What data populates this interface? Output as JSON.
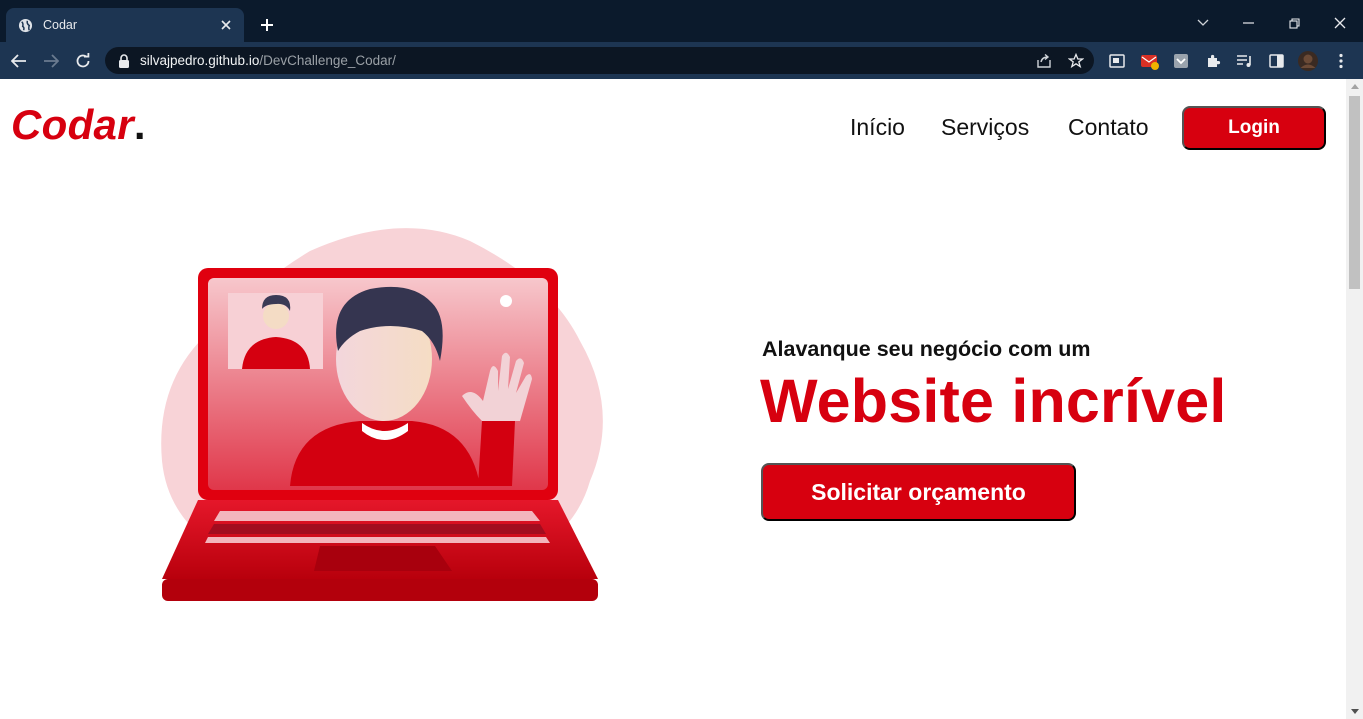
{
  "browser": {
    "tab_title": "Codar",
    "url_host": "silvajpedro.github.io",
    "url_path": "/DevChallenge_Codar/"
  },
  "site": {
    "logo_text": "Codar",
    "logo_dot": ".",
    "nav": {
      "inicio": "Início",
      "servicos": "Serviços",
      "contato": "Contato"
    },
    "login_label": "Login",
    "hero": {
      "subtitle": "Alavanque seu negócio com um",
      "headline": "Website incrível",
      "cta_label": "Solicitar orçamento"
    }
  },
  "colors": {
    "brand_red": "#d7000f",
    "chrome_dark": "#0b1a2c",
    "chrome_toolbar": "#1d3552"
  },
  "icons": [
    "globe-icon",
    "close-icon",
    "plus-icon",
    "chevron-down-icon",
    "minimize-icon",
    "restore-icon",
    "back-icon",
    "forward-icon",
    "reload-icon",
    "lock-icon",
    "share-icon",
    "star-icon",
    "extensions-icon",
    "side-panel-icon",
    "profile-avatar",
    "more-icon"
  ]
}
